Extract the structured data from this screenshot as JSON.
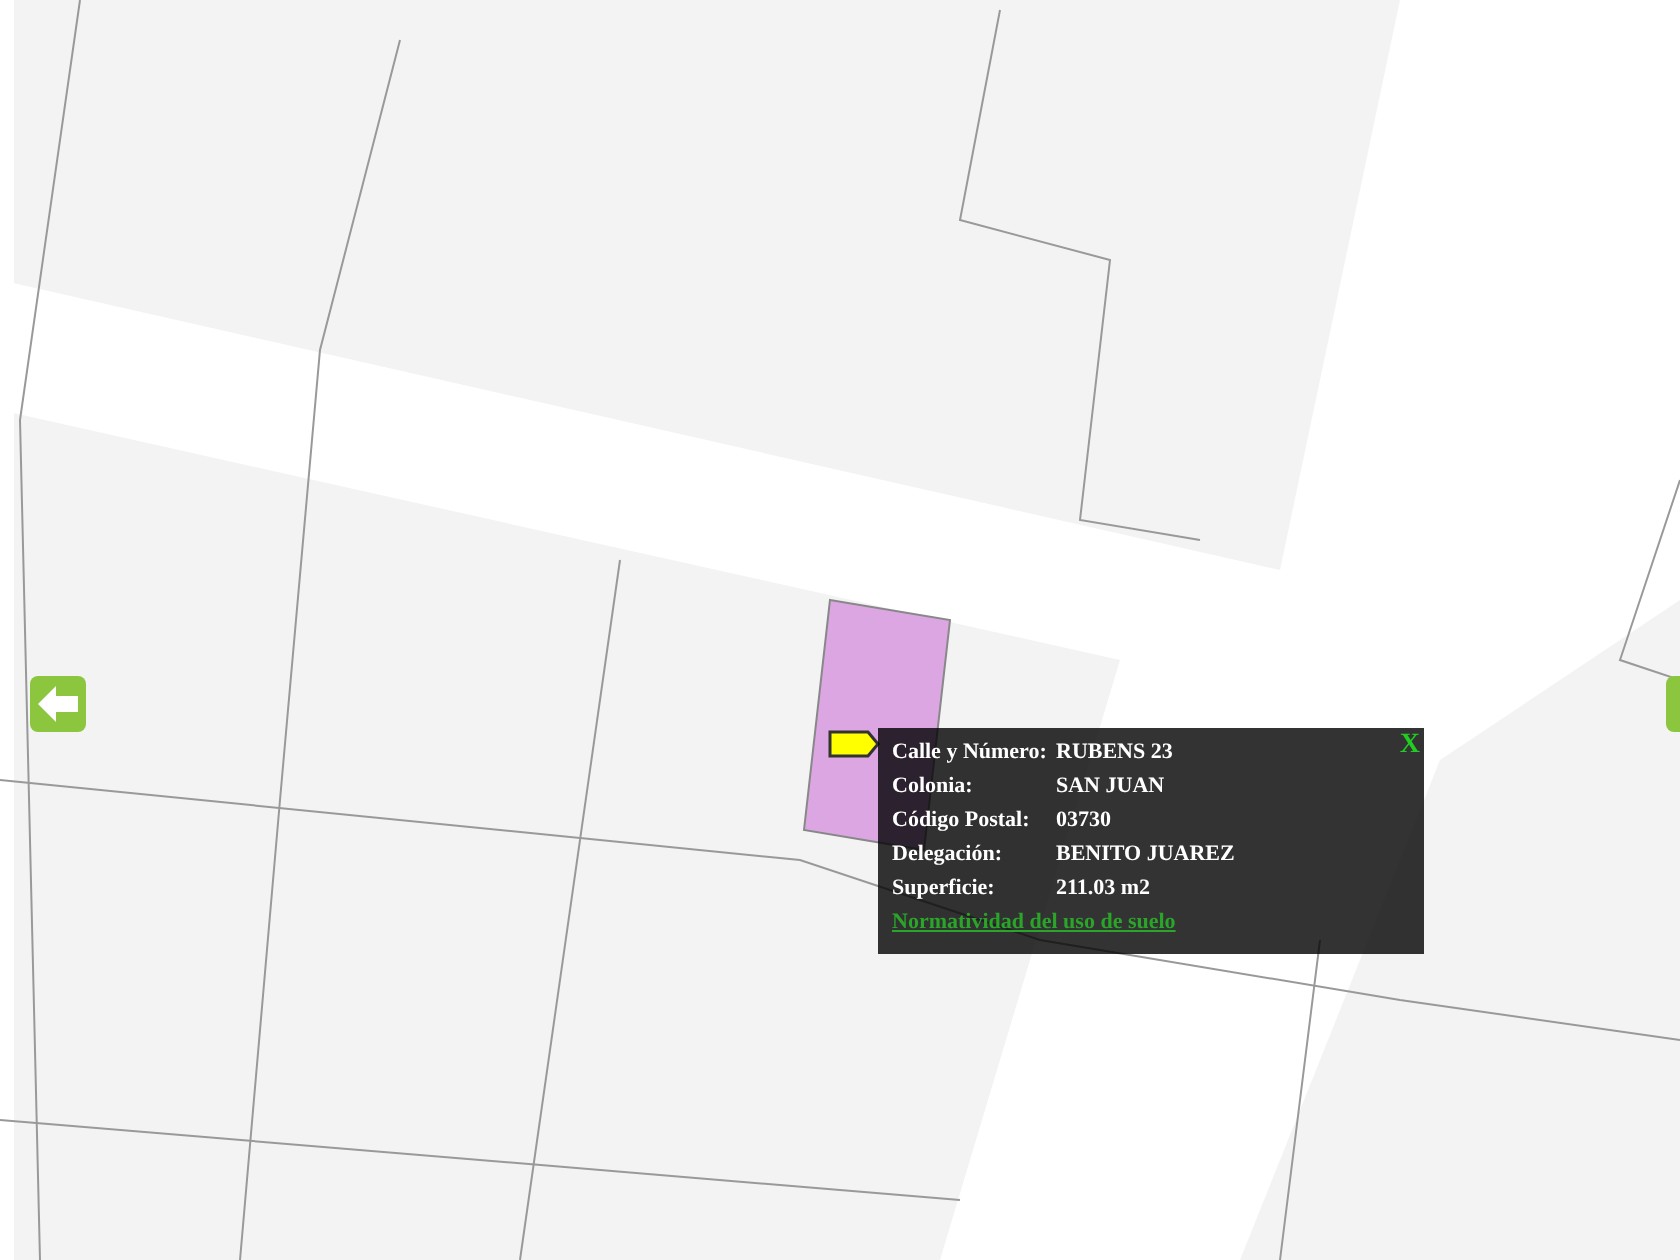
{
  "popup": {
    "close": "X",
    "fields": [
      {
        "label": "Calle y Número:",
        "value": "RUBENS 23"
      },
      {
        "label": "Colonia:",
        "value": "SAN JUAN"
      },
      {
        "label": "Código Postal:",
        "value": "03730"
      },
      {
        "label": "Delegación:",
        "value": "BENITO JUAREZ"
      },
      {
        "label": "Superficie:",
        "value": "211.03 m2"
      }
    ],
    "link": "Normatividad del uso de suelo"
  }
}
